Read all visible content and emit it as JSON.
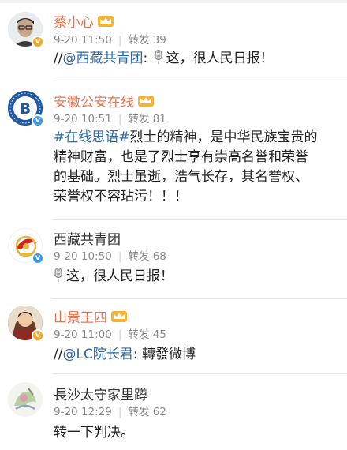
{
  "items": [
    {
      "name": "蔡小心",
      "date": "9-20 11:50",
      "repost_label": "转发",
      "repost_count": "39",
      "text_prefix": "//",
      "mention": "@西藏共青团",
      "text_rest": ": ",
      "text_after_icon": "这，很人民日报！"
    },
    {
      "name": "安徽公安在线",
      "date": "9-20 10:51",
      "repost_label": "转发",
      "repost_count": "81",
      "topic": "#在线思语#",
      "line1_rest": "烈士的精神，是中华民族宝贵的",
      "line2": "精神财富，也是了烈士享有崇高名誉和荣誉",
      "line3": "的基础。烈士虽逝，浩气长存，其名誉权、",
      "line4": "荣誉权不容玷污！！！"
    },
    {
      "name": "西藏共青团",
      "date": "9-20 10:50",
      "repost_label": "转发",
      "repost_count": "68",
      "text_after_icon": "这，很人民日报！"
    },
    {
      "name": "山景王四",
      "date": "9-20 11:00",
      "repost_label": "转发",
      "repost_count": "45",
      "text_prefix": "//",
      "mention": "@LC院长君",
      "text_rest": ": 轉發微博"
    },
    {
      "name": "長沙太守家里蹲",
      "date": "9-20 12:29",
      "repost_label": "转发",
      "repost_count": "62",
      "text": "转一下判决。"
    }
  ],
  "colors": {
    "name_highlight": "#eb7350",
    "link": "#2f6aa6",
    "meta": "#8a8a8a",
    "divider": "#e6e6e6",
    "badge_gold": "#f5a623",
    "badge_blue": "#3d9ae8"
  },
  "icons": [
    "crown-icon",
    "verified-badge-icon",
    "microphone-emoji-icon"
  ]
}
